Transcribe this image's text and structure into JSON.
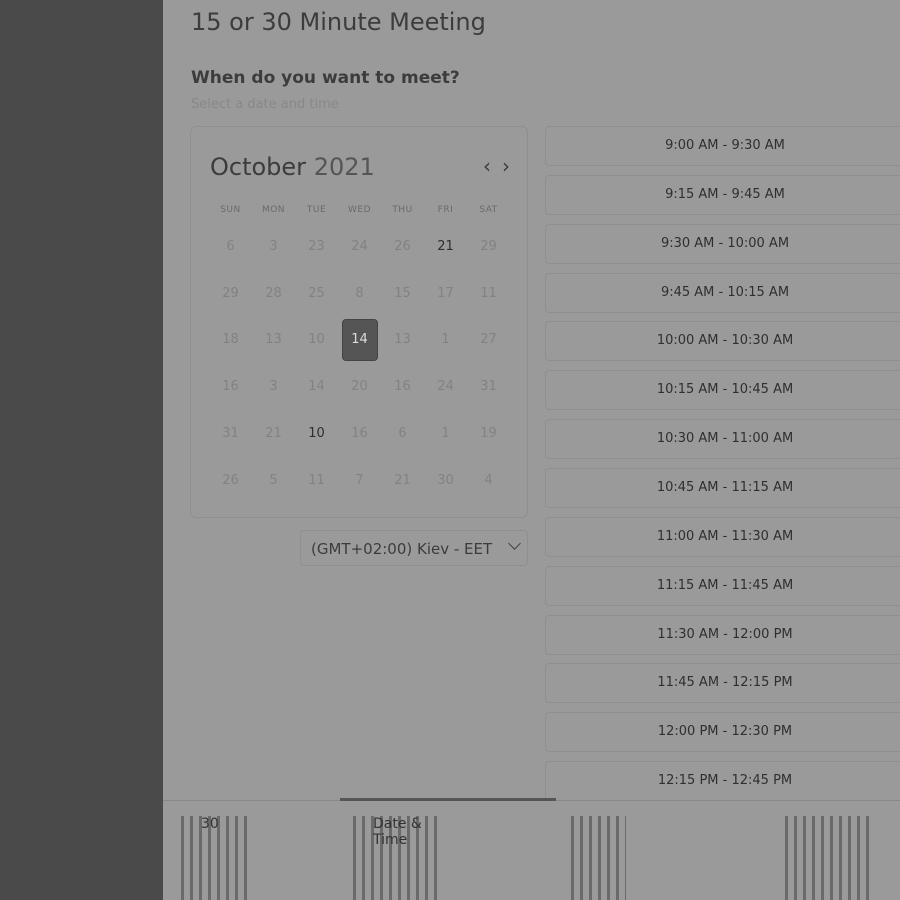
{
  "header": {
    "title": "15 or 30 Minute Meeting",
    "question": "When do you want to meet?",
    "subtitle": "Select a date and time"
  },
  "calendar": {
    "month": "October",
    "year": "2021",
    "prev_icon": "chevron-left-icon",
    "next_icon": "chevron-right-icon",
    "weekdays": [
      "SUN",
      "MON",
      "TUE",
      "WED",
      "THU",
      "FRI",
      "SAT"
    ],
    "weeks": [
      [
        "6",
        "3",
        "23",
        "24",
        "26",
        "21",
        "29"
      ],
      [
        "29",
        "28",
        "25",
        "8",
        "15",
        "17",
        "11"
      ],
      [
        "18",
        "13",
        "10",
        "14",
        "13",
        "1",
        "27"
      ],
      [
        "16",
        "3",
        "14",
        "20",
        "16",
        "24",
        "31"
      ],
      [
        "31",
        "21",
        "10",
        "16",
        "6",
        "1",
        "19"
      ],
      [
        "26",
        "5",
        "11",
        "7",
        "21",
        "30",
        "4"
      ]
    ],
    "available": [
      [
        0,
        5
      ],
      [
        4,
        2
      ]
    ],
    "selected": [
      2,
      3
    ]
  },
  "timezone": {
    "label": "(GMT+02:00) Kiev - EET",
    "icon": "chevron-down-icon"
  },
  "slots": [
    "9:00 AM - 9:30 AM",
    "9:15 AM - 9:45 AM",
    "9:30 AM - 10:00 AM",
    "9:45 AM - 10:15 AM",
    "10:00 AM - 10:30 AM",
    "10:15 AM - 10:45 AM",
    "10:30 AM - 11:00 AM",
    "10:45 AM - 11:15 AM",
    "11:00 AM - 11:30 AM",
    "11:15 AM - 11:45 AM",
    "11:30 AM - 12:00 PM",
    "11:45 AM - 12:15 PM",
    "12:00 PM - 12:30 PM",
    "12:15 PM - 12:45 PM"
  ],
  "tabs": [
    {
      "label": "30"
    },
    {
      "label": "Date & Time"
    },
    {
      "label": ""
    },
    {
      "label": ""
    }
  ]
}
